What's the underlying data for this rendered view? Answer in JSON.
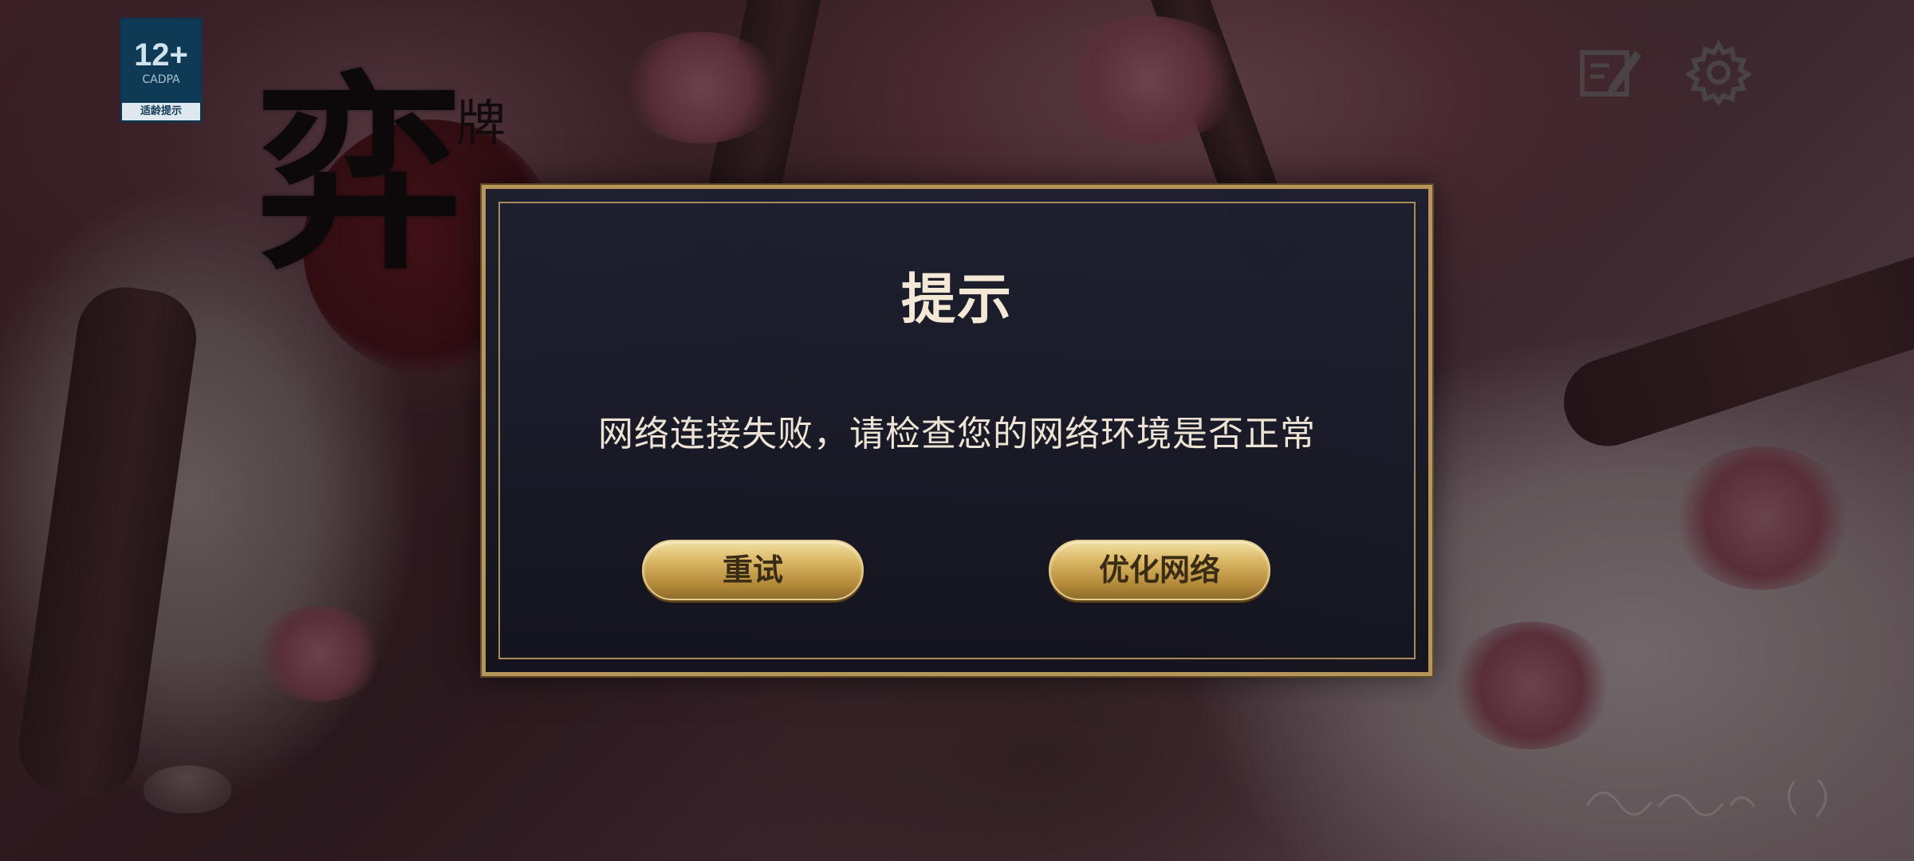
{
  "app": {
    "logo_text": "弈",
    "logo_subtext": "牌"
  },
  "age_rating": {
    "number": "12+",
    "subtitle": "CADPA",
    "footer": "适龄提示"
  },
  "toolbar": {
    "notice_icon": "edit-notice-icon",
    "settings_icon": "gear-icon"
  },
  "dialog": {
    "title": "提示",
    "message": "网络连接失败，请检查您的网络环境是否正常",
    "retry_label": "重试",
    "optimize_label": "优化网络"
  },
  "colors": {
    "dialog_border": "#b8955a",
    "dialog_bg": "#1e2030",
    "button_gold": "#d9b663",
    "title_text": "#f3e9d6"
  }
}
